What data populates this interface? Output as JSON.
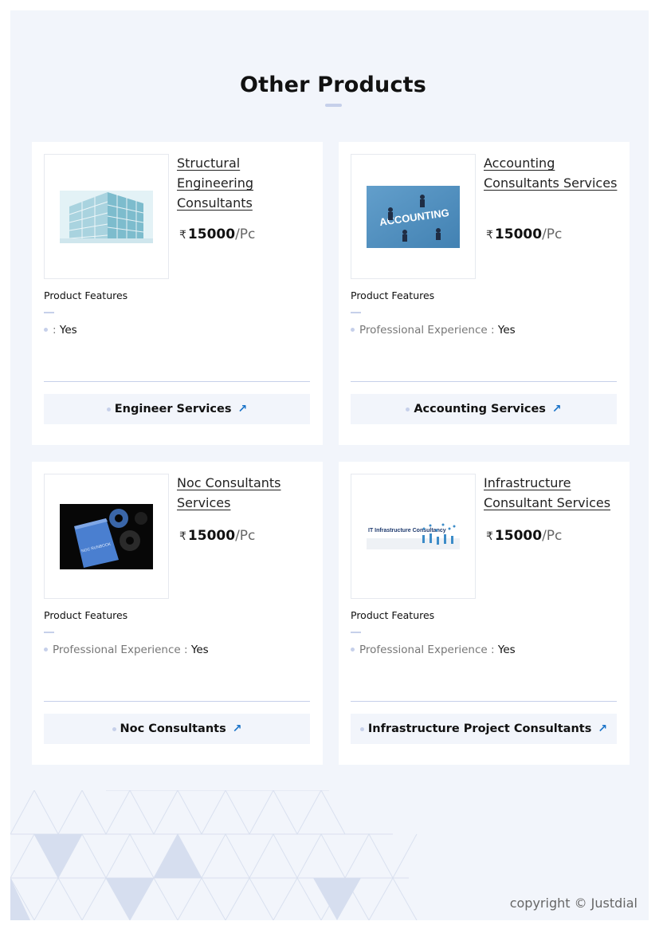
{
  "section": {
    "title": "Other Products"
  },
  "products": [
    {
      "title": "Structural Engineering Consultants",
      "currency": "₹",
      "price": "15000",
      "unit": "/Pc",
      "features_label": "Product Features",
      "feature_name": "",
      "feature_sep": ":",
      "feature_value": "Yes",
      "category": "Engineer Services",
      "image": "building-image"
    },
    {
      "title": "Accounting Consultants Services",
      "currency": "₹",
      "price": "15000",
      "unit": "/Pc",
      "features_label": "Product Features",
      "feature_name": "Professional Experience",
      "feature_sep": ":",
      "feature_value": "Yes",
      "category": "Accounting Services",
      "image": "accounting-image",
      "image_text": "ACCOUNTING"
    },
    {
      "title": "Noc Consultants Services",
      "currency": "₹",
      "price": "15000",
      "unit": "/Pc",
      "features_label": "Product Features",
      "feature_name": "Professional Experience",
      "feature_sep": ":",
      "feature_value": "Yes",
      "category": "Noc Consultants",
      "image": "noc-runbook-image",
      "image_text": "NOC RUNBOOK"
    },
    {
      "title": "Infrastructure Consultant Services",
      "currency": "₹",
      "price": "15000",
      "unit": "/Pc",
      "features_label": "Product Features",
      "feature_name": "Professional Experience",
      "feature_sep": ":",
      "feature_value": "Yes",
      "category": "Infrastructure Project Consultants",
      "image": "it-infrastructure-image",
      "image_text": "IT Infrastructure Consultancy"
    }
  ],
  "footer": {
    "copyright": "copyright © Justdial"
  },
  "colors": {
    "accent": "#1a73c8",
    "background": "#f2f5fb",
    "divider": "#c6d0ea"
  }
}
